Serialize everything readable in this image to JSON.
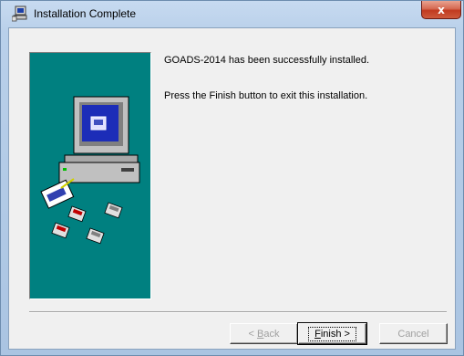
{
  "window": {
    "title": "Installation Complete",
    "close_glyph": "x",
    "app_icon": "installer-computer-icon"
  },
  "content": {
    "line1": "GOADS-2014 has been successfully installed.",
    "line2": "Press the Finish button to exit this installation."
  },
  "buttons": {
    "back": {
      "prefix": "< ",
      "accel": "B",
      "rest": "ack"
    },
    "finish": {
      "accel": "F",
      "rest": "inish >"
    },
    "cancel": "Cancel"
  },
  "colors": {
    "side_panel": "#008080",
    "close_button": "#c13a20"
  }
}
